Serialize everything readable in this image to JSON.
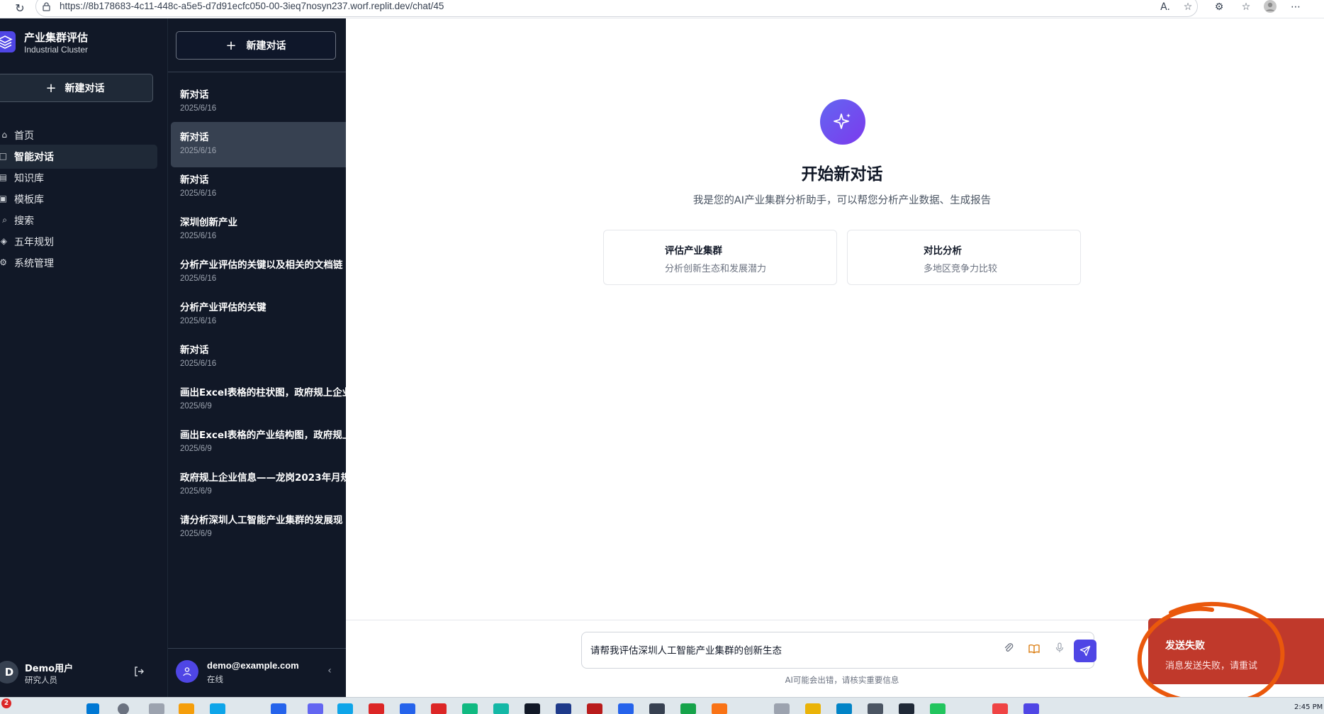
{
  "browser": {
    "url": "https://8b178683-4c11-448c-a5e5-d7d91ecfc050-00-3ieq7nosyn237.worf.replit.dev/chat/45",
    "icons": [
      "reload-icon",
      "lock-icon",
      "read-aloud-icon",
      "favorite-icon",
      "extensions-icon",
      "favorites-bar-icon",
      "profile-icon",
      "more-icon"
    ]
  },
  "sidebar": {
    "brand_title": "产业集群评估",
    "brand_subtitle": "Industrial Cluster",
    "new_chat_label": "新建对话",
    "nav": [
      {
        "label": "首页",
        "icon": "home-icon"
      },
      {
        "label": "智能对话",
        "icon": "chat-icon",
        "active": true
      },
      {
        "label": "知识库",
        "icon": "book-icon"
      },
      {
        "label": "模板库",
        "icon": "template-icon"
      },
      {
        "label": "搜索",
        "icon": "search-icon"
      },
      {
        "label": "五年规划",
        "icon": "plan-icon"
      },
      {
        "label": "系统管理",
        "icon": "gear-icon"
      }
    ],
    "user": {
      "avatar": "D",
      "name": "Demo用户",
      "role": "研究人员"
    }
  },
  "history": {
    "new_chat_label": "新建对话",
    "items": [
      {
        "title": "新对话",
        "date": "2025/6/16"
      },
      {
        "title": "新对话",
        "date": "2025/6/16",
        "active": true
      },
      {
        "title": "新对话",
        "date": "2025/6/16"
      },
      {
        "title": "深圳创新产业",
        "date": "2025/6/16"
      },
      {
        "title": "分析产业评估的关键以及相关的文档链",
        "date": "2025/6/16"
      },
      {
        "title": "分析产业评估的关键",
        "date": "2025/6/16"
      },
      {
        "title": "新对话",
        "date": "2025/6/16"
      },
      {
        "title": "画出Excel表格的柱状图，政府规上企业",
        "date": "2025/6/9"
      },
      {
        "title": "画出Excel表格的产业结构图，政府规上",
        "date": "2025/6/9"
      },
      {
        "title": "政府规上企业信息——龙岗2023年月规",
        "date": "2025/6/9"
      },
      {
        "title": "请分析深圳人工智能产业集群的发展现",
        "date": "2025/6/9"
      }
    ],
    "user": {
      "email": "demo@example.com",
      "status": "在线"
    }
  },
  "main": {
    "hero_title": "开始新对话",
    "hero_subtitle": "我是您的AI产业集群分析助手，可以帮您分析产业数据、生成报告",
    "cards": [
      {
        "title": "评估产业集群",
        "subtitle": "分析创新生态和发展潜力"
      },
      {
        "title": "对比分析",
        "subtitle": "多地区竞争力比较"
      }
    ],
    "input_value": "请帮我评估深圳人工智能产业集群的创新生态",
    "disclaimer": "AI可能会出错，请核实重要信息"
  },
  "toast": {
    "title": "发送失败",
    "message": "消息发送失败，请重试",
    "color": "#c0392b"
  },
  "taskbar": {
    "badge": "2",
    "time": "2:45 PM"
  },
  "colors": {
    "sidebar_bg": "#111827",
    "accent": "#4f46e5",
    "annotation": "#ea580c"
  }
}
